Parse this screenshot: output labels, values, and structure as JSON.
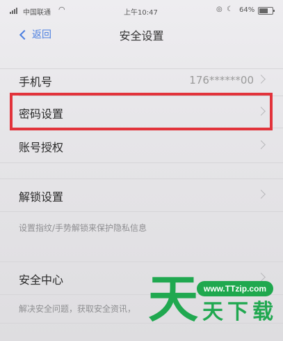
{
  "status_bar": {
    "carrier": "中国联通",
    "time": "上午10:47",
    "battery": "64%",
    "battery_level": 0.64,
    "icons": [
      "signal-icon",
      "wifi-icon",
      "alarm-icon",
      "moon-icon",
      "battery-icon"
    ]
  },
  "nav": {
    "back_label": "返回",
    "title": "安全设置"
  },
  "rows": [
    {
      "label": "手机号",
      "value": "176******00"
    },
    {
      "label": "密码设置"
    },
    {
      "label": "账号授权"
    },
    {
      "label": "解锁设置"
    },
    {
      "label": "安全中心"
    }
  ],
  "captions": {
    "unlock": "设置指纹/手势解锁来保护隐私信息",
    "security": "解决安全问题，获取安全资讯，"
  },
  "watermark": {
    "url": "www.TTzip.com",
    "big_char": "天",
    "text": "天下载"
  },
  "colors": {
    "accent": "#4a7ee0",
    "highlight": "#e2333b",
    "watermark": "#20a850"
  }
}
